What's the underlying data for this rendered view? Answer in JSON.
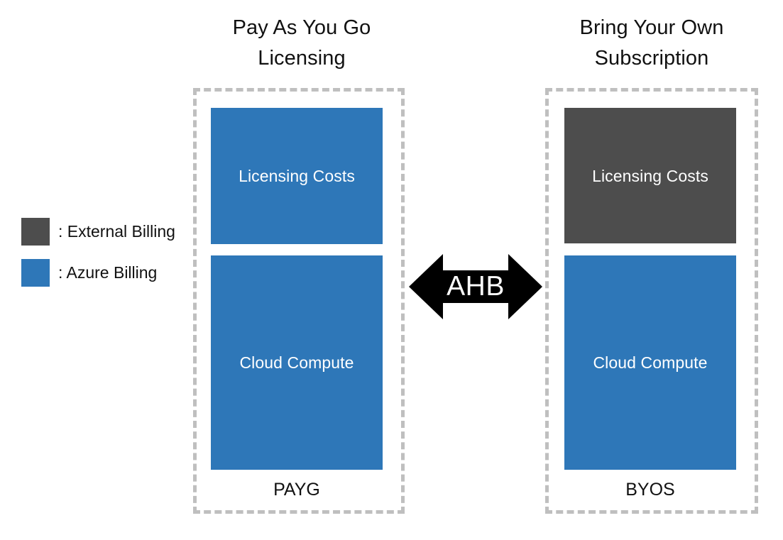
{
  "columns": [
    {
      "title": "Pay As You Go\nLicensing",
      "footer_label": "PAYG",
      "blocks": [
        {
          "label": "Licensing Costs",
          "billing": "Azure Billing",
          "color": "#2e77b8"
        },
        {
          "label": "Cloud Compute",
          "billing": "Azure Billing",
          "color": "#2e77b8"
        }
      ]
    },
    {
      "title": "Bring Your Own\nSubscription",
      "footer_label": "BYOS",
      "blocks": [
        {
          "label": "Licensing Costs",
          "billing": "External Billing",
          "color": "#4d4d4d"
        },
        {
          "label": "Cloud Compute",
          "billing": "Azure Billing",
          "color": "#2e77b8"
        }
      ]
    }
  ],
  "legend": {
    "items": [
      {
        "label": ": External Billing",
        "color": "#4d4d4d",
        "swatch": "external-billing-swatch"
      },
      {
        "label": ": Azure Billing",
        "color": "#2e77b8",
        "swatch": "azure-billing-swatch"
      }
    ]
  },
  "connector": {
    "label": "AHB",
    "icon": "double-headed-arrow-icon",
    "color": "#000000",
    "text_color": "#ffffff"
  },
  "styles": {
    "panel_border_color": "#bfbfbf",
    "background": "#ffffff",
    "title_color": "#111111"
  }
}
